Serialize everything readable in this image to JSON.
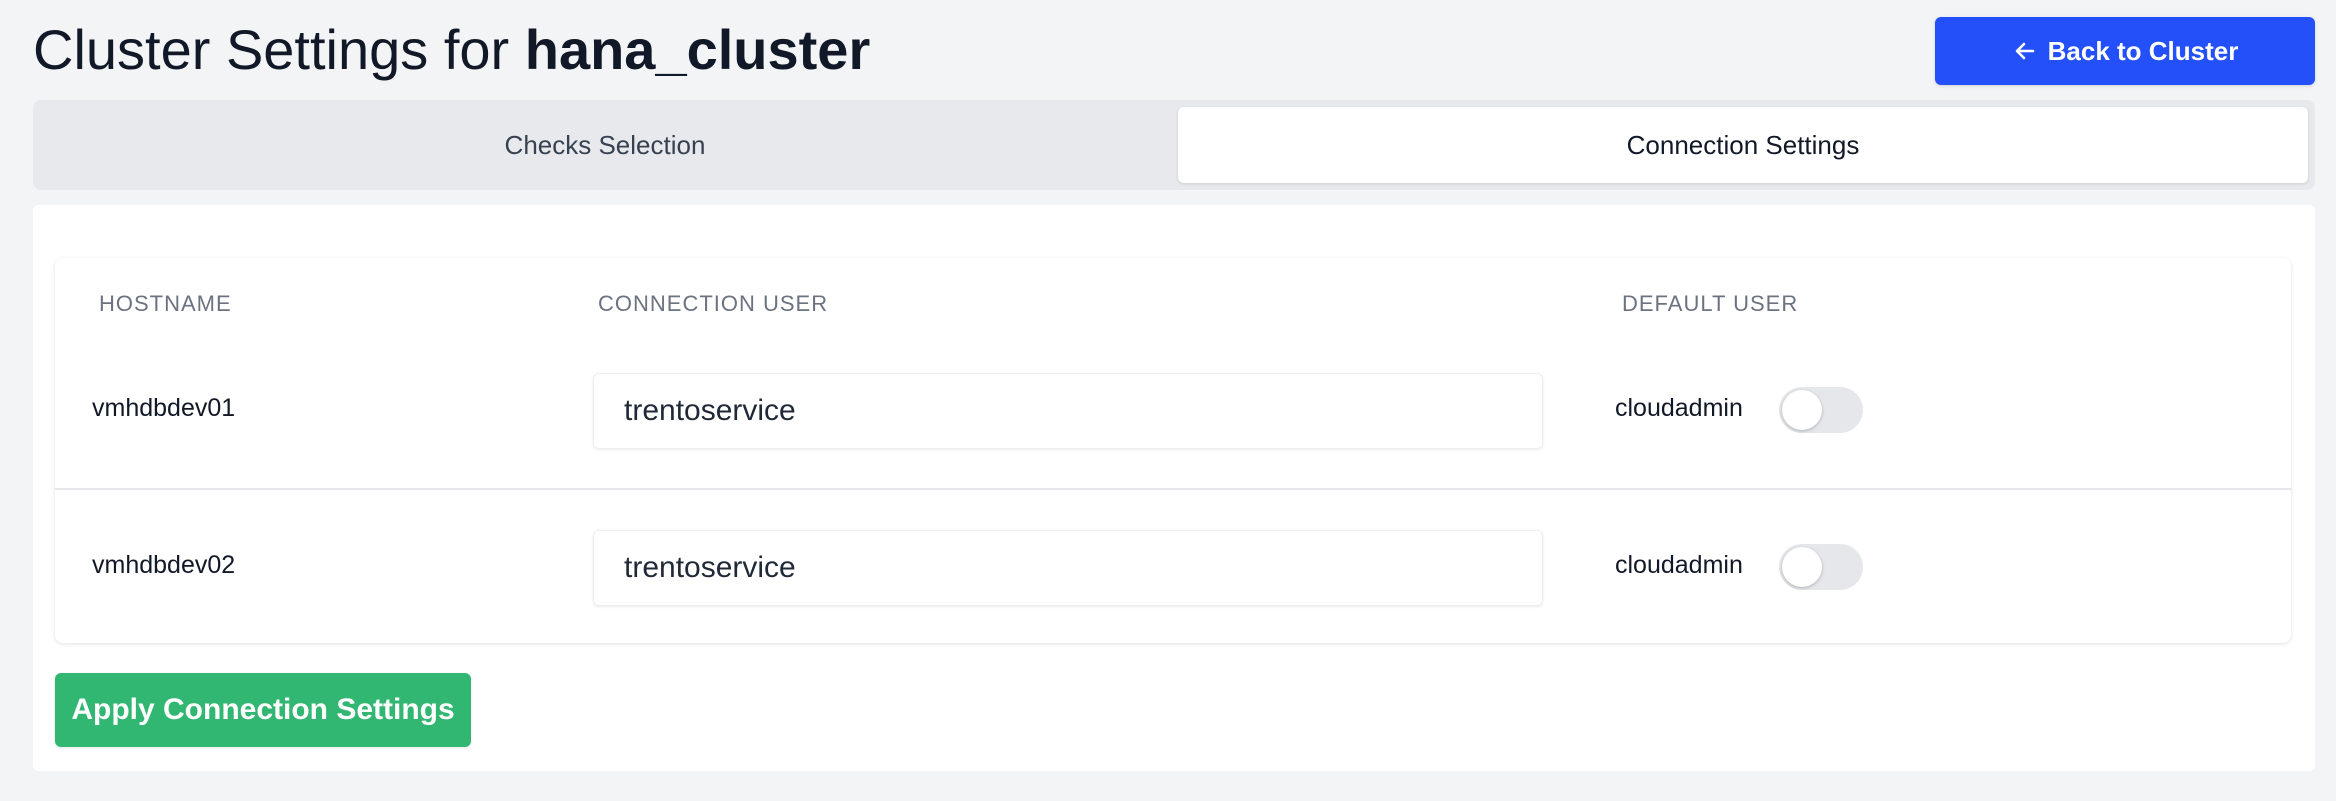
{
  "header": {
    "title_prefix": "Cluster Settings for ",
    "cluster_name": "hana_cluster",
    "back_button_label": "Back to Cluster"
  },
  "tabs": [
    {
      "label": "Checks Selection",
      "active": false
    },
    {
      "label": "Connection Settings",
      "active": true
    }
  ],
  "table": {
    "columns": [
      "HOSTNAME",
      "CONNECTION USER",
      "DEFAULT USER"
    ],
    "rows": [
      {
        "hostname": "vmhdbdev01",
        "connection_user": "trentoservice",
        "default_user": "cloudadmin",
        "use_default": false
      },
      {
        "hostname": "vmhdbdev02",
        "connection_user": "trentoservice",
        "default_user": "cloudadmin",
        "use_default": false
      }
    ]
  },
  "apply_button_label": "Apply Connection Settings",
  "colors": {
    "primary_blue": "#2450fa",
    "success_green": "#31b771",
    "background": "#f3f4f6"
  },
  "icons": {
    "back": "arrow-left-icon"
  }
}
